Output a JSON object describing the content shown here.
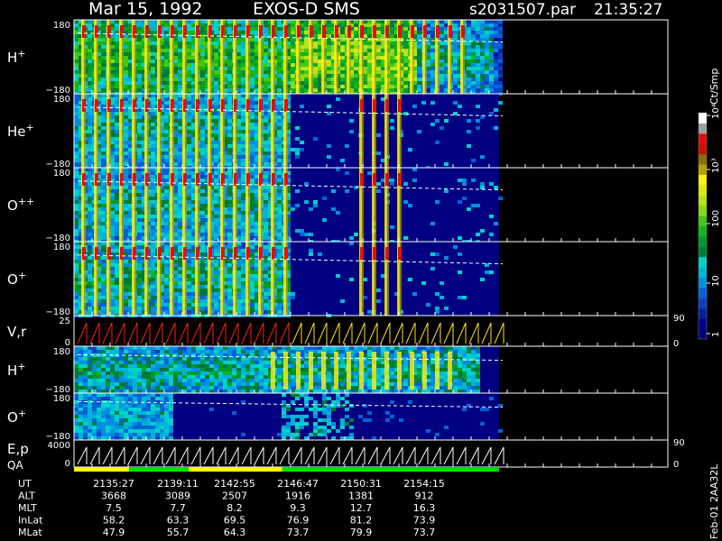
{
  "header": {
    "date": "Mar 15, 1992",
    "instrument": "EXOS-D SMS",
    "file": "s2031507.par",
    "time": "21:35:27"
  },
  "colorbar": {
    "label": "Ct/Smp",
    "tick_labels": [
      "1",
      "10",
      "100",
      "10³",
      "10⁴"
    ],
    "colors": [
      "#000080",
      "#00008b",
      "#0a1fa0",
      "#0d3fc0",
      "#0062d8",
      "#008ee0",
      "#00b4d8",
      "#00d2c8",
      "#007a3a",
      "#009a30",
      "#12b51a",
      "#40c818",
      "#8ad81a",
      "#b9e21e",
      "#e0ea1a",
      "#fff019",
      "#b6a000",
      "#8a6e00",
      "#c81400",
      "#e01010",
      "#a0a0a0",
      "#ffffff"
    ]
  },
  "chart_data": {
    "type": "heatmap",
    "x_range": [
      "21:35:27",
      "21:57:30"
    ],
    "x_tick_labels": [
      "2135:27",
      "2139:11",
      "2142:55",
      "2146:47",
      "2150:31",
      "2154:15"
    ],
    "panels": [
      {
        "label": "H",
        "sup": "+",
        "ylim": [
          -180,
          180
        ],
        "y_ticks": [
          "180",
          "−180"
        ],
        "kind": "heatmap",
        "regime": "h1"
      },
      {
        "label": "He",
        "sup": "+",
        "ylim": [
          -180,
          180
        ],
        "y_ticks": [
          "180",
          "−180"
        ],
        "kind": "heatmap",
        "regime": "heavy"
      },
      {
        "label": "O",
        "sup": "++",
        "ylim": [
          -180,
          180
        ],
        "y_ticks": [
          "180",
          "−180"
        ],
        "kind": "heatmap",
        "regime": "heavy"
      },
      {
        "label": "O",
        "sup": "+",
        "ylim": [
          -180,
          180
        ],
        "y_ticks": [
          "180",
          "−180"
        ],
        "kind": "heatmap",
        "regime": "oplus"
      },
      {
        "label": "V,r",
        "sup": "",
        "ylim": [
          0,
          25
        ],
        "y_ticks": [
          "25",
          "0"
        ],
        "right_ticks": [
          "90",
          "0"
        ],
        "kind": "sawtooth"
      },
      {
        "label": "H",
        "sup": "+",
        "ylim": [
          -180,
          180
        ],
        "y_ticks": [
          "180",
          "−180"
        ],
        "kind": "heatmap",
        "regime": "h2"
      },
      {
        "label": "O",
        "sup": "+",
        "ylim": [
          -180,
          180
        ],
        "y_ticks": [
          "180",
          "−180"
        ],
        "kind": "heatmap",
        "regime": "o2"
      },
      {
        "label": "E,p",
        "sub_label": "QA",
        "sup": "",
        "ylim": [
          0,
          4000
        ],
        "y_ticks": [
          "4000",
          "0"
        ],
        "right_ticks": [
          "90",
          "0"
        ],
        "kind": "sawtooth2"
      }
    ],
    "orbit_rows": [
      {
        "label": "UT",
        "values": [
          "2135:27",
          "2139:11",
          "2142:55",
          "2146:47",
          "2150:31",
          "2154:15"
        ]
      },
      {
        "label": "ALT",
        "values": [
          "3668",
          "3089",
          "2507",
          "1916",
          "1381",
          "912"
        ]
      },
      {
        "label": "MLT",
        "values": [
          "7.5",
          "7.7",
          "8.2",
          "9.3",
          "12.7",
          "16.3"
        ]
      },
      {
        "label": "InLat",
        "values": [
          "58.2",
          "63.3",
          "69.5",
          "76.9",
          "81.2",
          "73.9"
        ]
      },
      {
        "label": "MLat",
        "values": [
          "47.9",
          "55.7",
          "64.3",
          "73.7",
          "79.9",
          "73.7"
        ]
      }
    ],
    "qa_bar": [
      {
        "from": 0.0,
        "to": 0.13,
        "color": "#ffff00"
      },
      {
        "from": 0.13,
        "to": 0.27,
        "color": "#00e000"
      },
      {
        "from": 0.27,
        "to": 0.49,
        "color": "#ffff00"
      },
      {
        "from": 0.49,
        "to": 1.0,
        "color": "#00e000"
      }
    ]
  },
  "footer": {
    "vertical_label": "Feb-01 2AA32L"
  }
}
